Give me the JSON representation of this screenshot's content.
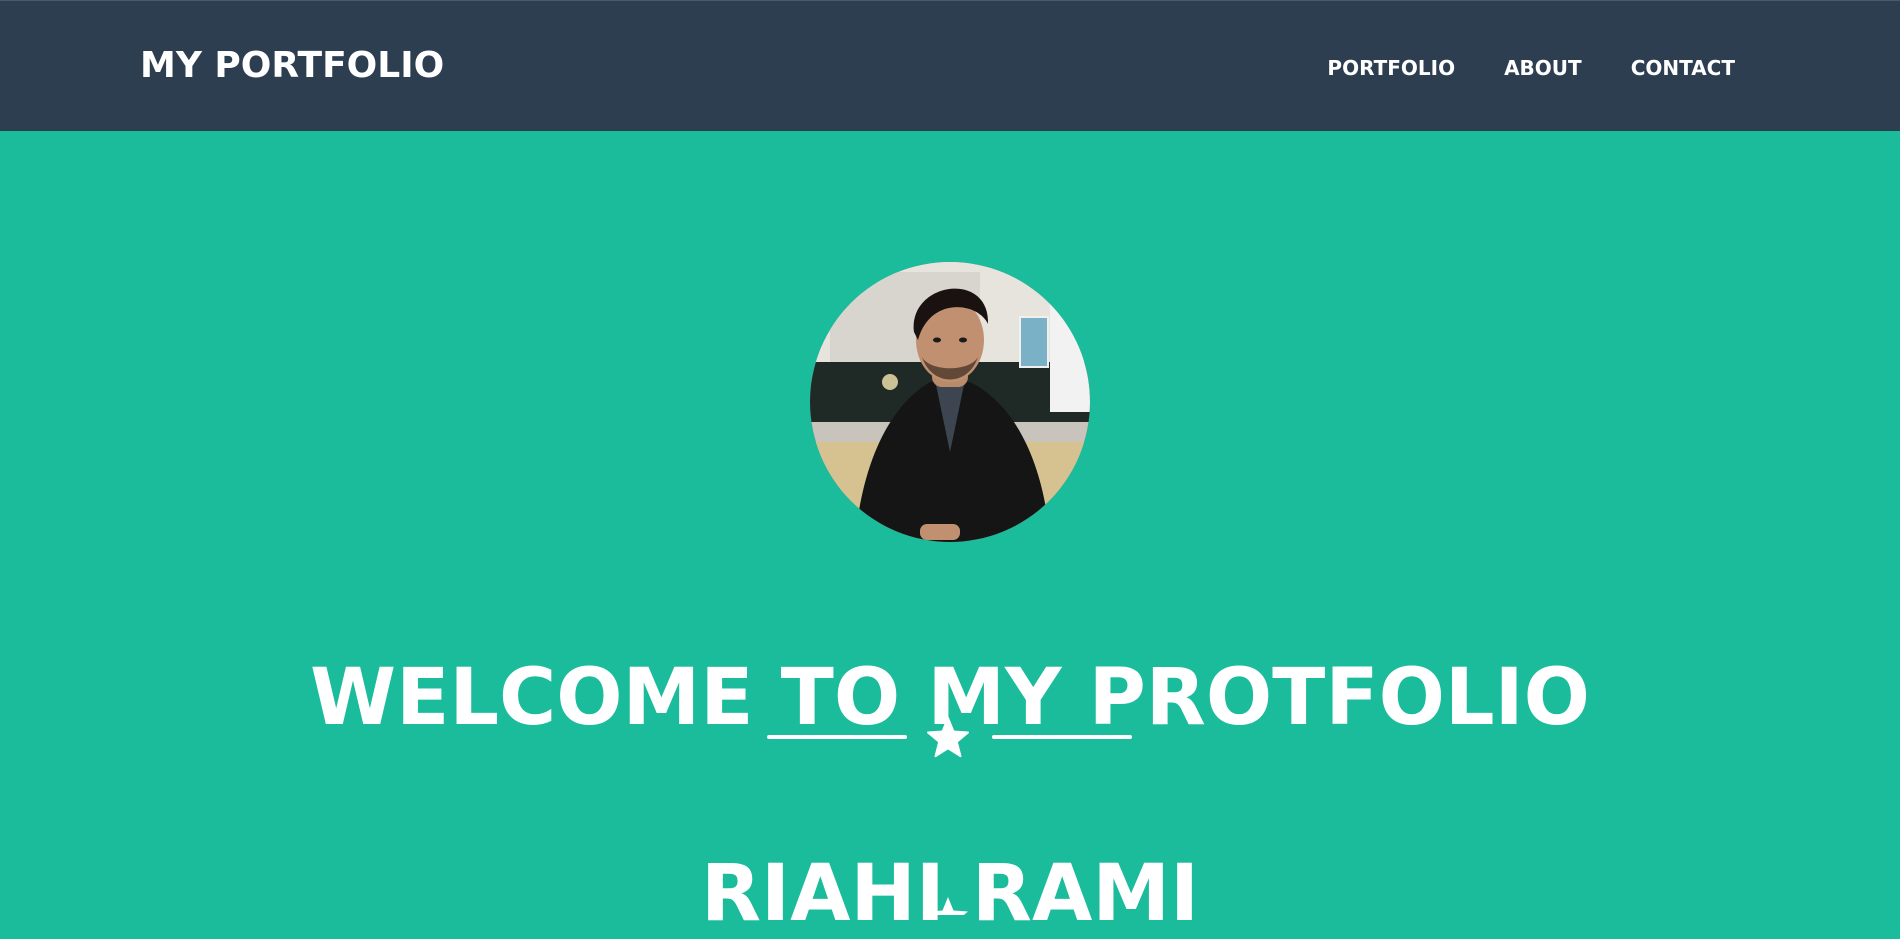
{
  "colors": {
    "navbar_bg": "#2c3e50",
    "hero_bg": "#1abc9c",
    "text": "#ffffff"
  },
  "navbar": {
    "brand": "MY PORTFOLIO",
    "links": [
      {
        "label": "PORTFOLIO"
      },
      {
        "label": "ABOUT"
      },
      {
        "label": "CONTACT"
      }
    ]
  },
  "masthead": {
    "avatar_icon": "profile-photo",
    "headline": "WELCOME TO MY PROTFOLIO",
    "divider_icon": "star-icon",
    "name": "RIAHI RAMI"
  }
}
